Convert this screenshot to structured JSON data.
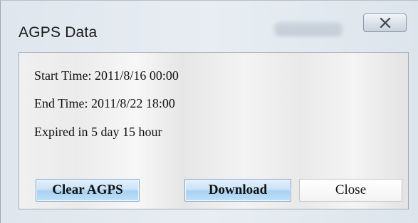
{
  "window": {
    "title": "AGPS Data"
  },
  "info": {
    "start_time": "Start Time: 2011/8/16 00:00",
    "end_time": "End Time: 2011/8/22 18:00",
    "expired": "Expired in 5 day 15 hour"
  },
  "buttons": {
    "clear_label": "Clear AGPS",
    "download_label": "Download",
    "close_label": "Close"
  },
  "icons": {
    "titlebar_close": "close-icon"
  }
}
